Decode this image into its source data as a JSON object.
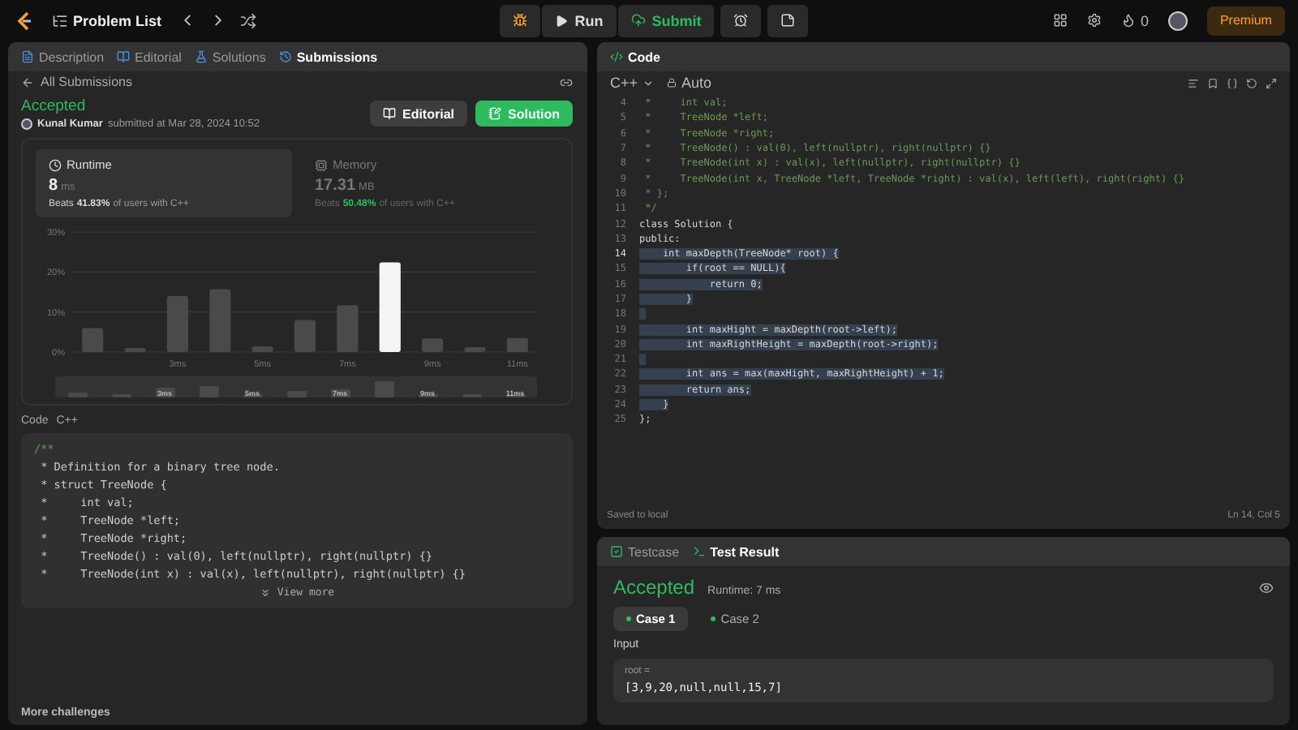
{
  "top_bar": {
    "problem_list": "Problem List",
    "run": "Run",
    "submit": "Submit",
    "streak": "0",
    "premium": "Premium"
  },
  "left_tabs": [
    {
      "label": "Description",
      "selected": false
    },
    {
      "label": "Editorial",
      "selected": false
    },
    {
      "label": "Solutions",
      "selected": false
    },
    {
      "label": "Submissions",
      "selected": true
    }
  ],
  "submission": {
    "back": "All Submissions",
    "status": "Accepted",
    "user": "Kunal Kumar",
    "submitted": "submitted at Mar 28, 2024 10:52",
    "editorial_button": "Editorial",
    "solution_button": "Solution",
    "stats": [
      {
        "title": "Runtime",
        "value": "8",
        "unit": "ms",
        "beats_prefix": "Beats",
        "beats": "41.83%",
        "beats_suffix": "of users with C++",
        "selected": true
      },
      {
        "title": "Memory",
        "value": "17.31",
        "unit": "MB",
        "beats_prefix": "Beats",
        "beats": "50.48%",
        "beats_suffix": "of users with C++",
        "selected": false
      }
    ],
    "chart_data": {
      "type": "bar",
      "x": [
        1,
        2,
        3,
        4,
        5,
        6,
        7,
        8,
        9,
        10,
        11
      ],
      "yticks": [
        {
          "value": 0,
          "label": "0%"
        },
        {
          "value": 10,
          "label": "10%"
        },
        {
          "value": 20,
          "label": "20%"
        },
        {
          "value": 30,
          "label": "30%"
        }
      ],
      "xticks": [
        {
          "value": 3,
          "label": "3ms"
        },
        {
          "value": 5,
          "label": "5ms"
        },
        {
          "value": 7,
          "label": "7ms"
        },
        {
          "value": 9,
          "label": "9ms"
        },
        {
          "value": 11,
          "label": "11ms"
        }
      ],
      "xlim": [
        0.5,
        11.5
      ],
      "ylim": [
        0,
        30
      ],
      "series": [
        {
          "color": "#4a4a4a",
          "values": [
            6,
            1,
            14,
            15.7,
            1.4,
            8,
            11.7,
            null,
            3.4,
            1.2,
            3.5
          ]
        },
        {
          "color": "#f5f5f5",
          "values": [
            null,
            null,
            null,
            null,
            null,
            null,
            null,
            22.4,
            null,
            null,
            null
          ]
        }
      ]
    },
    "overview_labels": [
      "3ms",
      "5ms",
      "7ms",
      "9ms",
      "11ms"
    ],
    "code_label": "Code",
    "code_language": "C++",
    "code_lines": [
      "/**",
      " * Definition for a binary tree node.",
      " * struct TreeNode {",
      " *     int val;",
      " *     TreeNode *left;",
      " *     TreeNode *right;",
      " *     TreeNode() : val(0), left(nullptr), right(nullptr) {}",
      " *     TreeNode(int x) : val(x), left(nullptr), right(nullptr) {}"
    ],
    "view_more": "View more",
    "more_challenges": "More challenges"
  },
  "editor": {
    "tab": "Code",
    "language": "C++",
    "mode": "Auto",
    "lines": [
      {
        "num": "4",
        "text": " *     int val;",
        "kind": "comment",
        "selected": false
      },
      {
        "num": "5",
        "text": " *     TreeNode *left;",
        "kind": "comment",
        "selected": false
      },
      {
        "num": "6",
        "text": " *     TreeNode *right;",
        "kind": "comment",
        "selected": false
      },
      {
        "num": "7",
        "text": " *     TreeNode() : val(0), left(nullptr), right(nullptr) {}",
        "kind": "comment",
        "selected": false
      },
      {
        "num": "8",
        "text": " *     TreeNode(int x) : val(x), left(nullptr), right(nullptr) {}",
        "kind": "comment",
        "selected": false
      },
      {
        "num": "9",
        "text": " *     TreeNode(int x, TreeNode *left, TreeNode *right) : val(x), left(left), right(right) {}",
        "kind": "comment",
        "selected": false
      },
      {
        "num": "10",
        "text": " * };",
        "kind": "comment",
        "selected": false
      },
      {
        "num": "11",
        "text": " */",
        "kind": "comment",
        "selected": false
      },
      {
        "num": "12",
        "text": "class Solution {",
        "kind": "code",
        "selected": false
      },
      {
        "num": "13",
        "text": "public:",
        "kind": "code",
        "selected": false
      },
      {
        "num": "14",
        "text": "    int maxDepth(TreeNode* root) {",
        "kind": "code",
        "selected": true
      },
      {
        "num": "15",
        "text": "        if(root == NULL){",
        "kind": "code",
        "selected": true
      },
      {
        "num": "16",
        "text": "            return 0;",
        "kind": "code",
        "selected": true
      },
      {
        "num": "17",
        "text": "        }",
        "kind": "code",
        "selected": true
      },
      {
        "num": "18",
        "kind": "code",
        "selected": true
      },
      {
        "num": "19",
        "text": "        int maxHight = maxDepth(root->left);",
        "kind": "code",
        "selected": true
      },
      {
        "num": "20",
        "text": "        int maxRightHeight = maxDepth(root->right);",
        "kind": "code",
        "selected": true
      },
      {
        "num": "21",
        "kind": "code",
        "selected": true
      },
      {
        "num": "22",
        "text": "        int ans = max(maxHight, maxRightHeight) + 1;",
        "kind": "code",
        "selected": true
      },
      {
        "num": "23",
        "text": "        return ans;",
        "kind": "code",
        "selected": true
      },
      {
        "num": "24",
        "text": "    }",
        "kind": "code",
        "selected": true
      },
      {
        "num": "25",
        "text": "};",
        "kind": "code",
        "selected": false
      }
    ],
    "saved": "Saved to local",
    "cursor": "Ln 14, Col 5"
  },
  "test_tabs": [
    {
      "label": "Testcase",
      "selected": false
    },
    {
      "label": "Test Result",
      "selected": true
    }
  ],
  "result": {
    "status": "Accepted",
    "runtime": "Runtime: 7 ms",
    "cases": [
      {
        "label": "Case 1",
        "selected": true
      },
      {
        "label": "Case 2",
        "selected": false
      }
    ],
    "input_label": "Input",
    "param": "root =",
    "value": "[3,9,20,null,null,15,7]"
  }
}
